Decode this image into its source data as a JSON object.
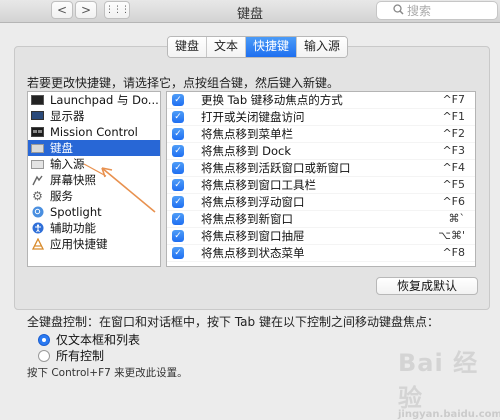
{
  "window": {
    "title": "键盘"
  },
  "nav": {
    "back": "<",
    "forward": ">",
    "grid": "⋮⋮⋮"
  },
  "search": {
    "placeholder": "搜索"
  },
  "tabs": [
    {
      "label": "键盘",
      "active": false
    },
    {
      "label": "文本",
      "active": false
    },
    {
      "label": "快捷键",
      "active": true
    },
    {
      "label": "输入源",
      "active": false
    }
  ],
  "instruction": "若要更改快捷键，请选择它，点按组合键，然后键入新键。",
  "categories": [
    {
      "label": "Launchpad 与 Do...",
      "icon": "launchpad-icon"
    },
    {
      "label": "显示器",
      "icon": "display-icon"
    },
    {
      "label": "Mission Control",
      "icon": "mission-control-icon"
    },
    {
      "label": "键盘",
      "icon": "keyboard-icon",
      "selected": true
    },
    {
      "label": "输入源",
      "icon": "input-source-icon"
    },
    {
      "label": "屏幕快照",
      "icon": "screenshot-icon"
    },
    {
      "label": "服务",
      "icon": "gear-icon"
    },
    {
      "label": "Spotlight",
      "icon": "spotlight-icon"
    },
    {
      "label": "辅助功能",
      "icon": "accessibility-icon"
    },
    {
      "label": "应用快捷键",
      "icon": "app-shortcuts-icon"
    }
  ],
  "shortcuts": [
    {
      "label": "更换 Tab 键移动焦点的方式",
      "key": "^F7",
      "checked": true
    },
    {
      "label": "打开或关闭键盘访问",
      "key": "^F1",
      "checked": true
    },
    {
      "label": "将焦点移到菜单栏",
      "key": "^F2",
      "checked": true
    },
    {
      "label": "将焦点移到 Dock",
      "key": "^F3",
      "checked": true
    },
    {
      "label": "将焦点移到活跃窗口或新窗口",
      "key": "^F4",
      "checked": true
    },
    {
      "label": "将焦点移到窗口工具栏",
      "key": "^F5",
      "checked": true
    },
    {
      "label": "将焦点移到浮动窗口",
      "key": "^F6",
      "checked": true
    },
    {
      "label": "将焦点移到新窗口",
      "key": "⌘`",
      "checked": true
    },
    {
      "label": "将焦点移到窗口抽屉",
      "key": "⌥⌘'",
      "checked": true
    },
    {
      "label": "将焦点移到状态菜单",
      "key": "^F8",
      "checked": true
    }
  ],
  "restore_button": "恢复成默认",
  "full_keyboard": {
    "label": "全键盘控制：在窗口和对话框中，按下 Tab 键在以下控制之间移动键盘焦点：",
    "options": [
      {
        "label": "仅文本框和列表",
        "selected": true
      },
      {
        "label": "所有控制",
        "selected": false
      }
    ]
  },
  "footer": "按下 Control+F7 来更改此设置。",
  "watermark": {
    "text": "Bai 经验",
    "sub": "jingyan.baidu.com"
  },
  "colors": {
    "accent": "#2867d6",
    "annotation": "#e8914f"
  }
}
